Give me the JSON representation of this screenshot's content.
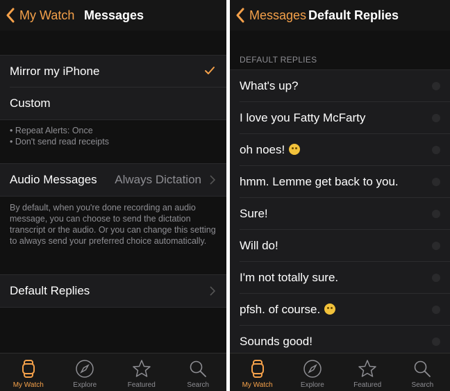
{
  "left": {
    "nav": {
      "back_label": "My Watch",
      "title": "Messages"
    },
    "options": [
      {
        "label": "Mirror my iPhone",
        "selected": true
      },
      {
        "label": "Custom",
        "selected": false
      }
    ],
    "mirror_notes": [
      "• Repeat Alerts: Once",
      "• Don't send read receipts"
    ],
    "audio": {
      "label": "Audio Messages",
      "value": "Always Dictation"
    },
    "audio_note": "By default, when you're done recording an audio message, you can choose to send the dictation transcript or the audio. Or you can change this setting to always send your preferred choice automatically.",
    "default_replies_label": "Default Replies"
  },
  "right": {
    "nav": {
      "back_label": "Messages",
      "title": "Default Replies"
    },
    "section_header": "DEFAULT REPLIES",
    "replies": [
      {
        "text": "What's up?"
      },
      {
        "text": "I love you Fatty McFarty"
      },
      {
        "text": "oh noes!",
        "emoji": "sad-face"
      },
      {
        "text": "hmm. Lemme get back to you."
      },
      {
        "text": "Sure!"
      },
      {
        "text": "Will do!"
      },
      {
        "text": "I'm not totally sure."
      },
      {
        "text": "pfsh. of course.",
        "emoji": "smirk-face"
      },
      {
        "text": "Sounds good!"
      }
    ]
  },
  "tabs": [
    {
      "label": "My Watch",
      "icon": "watch-icon",
      "active": true
    },
    {
      "label": "Explore",
      "icon": "compass-icon",
      "active": false
    },
    {
      "label": "Featured",
      "icon": "star-icon",
      "active": false
    },
    {
      "label": "Search",
      "icon": "search-icon",
      "active": false
    }
  ],
  "colors": {
    "accent": "#f5a14a",
    "background": "#111111",
    "cell": "#1c1c1e",
    "secondary_text": "#8e8e93"
  }
}
